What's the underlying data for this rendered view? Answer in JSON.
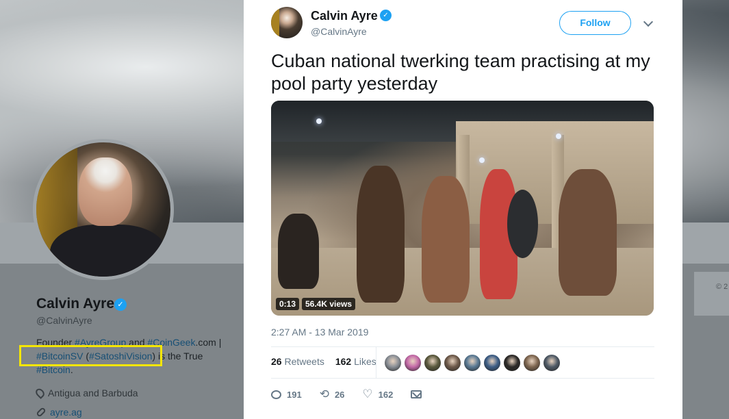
{
  "profile": {
    "name": "Calvin Ayre",
    "verified_mark": "✓",
    "handle": "@CalvinAyre",
    "bio": {
      "line1_prefix": "Founder ",
      "tag_ayre": "#AyreGroup",
      "and": " and ",
      "tag_coingeek": "#CoinGeek",
      "com": ".com |",
      "tag_bitcoinsv": "#BitcoinSV",
      "paren_open": " (",
      "tag_satoshi": "#SatoshiVision",
      "paren_close": ")",
      "is_true": " is the True",
      "tag_bitcoin": "#Bitcoin",
      "period": "."
    },
    "location": "Antigua and Barbuda",
    "website": "ayre.ag",
    "side_card_text": "© 2"
  },
  "tweet": {
    "author_name": "Calvin Ayre",
    "verified_mark": "✓",
    "author_handle": "@CalvinAyre",
    "follow_label": "Follow",
    "text": "Cuban national twerking team practising at my pool party yesterday",
    "video": {
      "duration": "0:13",
      "views": "56.4K views"
    },
    "timestamp": "2:27 AM - 13 Mar 2019",
    "stats": {
      "retweets_count": "26",
      "retweets_label": "Retweets",
      "likes_count": "162",
      "likes_label": "Likes"
    },
    "liker_colors": [
      "#8a8f96",
      "#c46aa8",
      "#5b5a3e",
      "#6e5a4a",
      "#5a7a94",
      "#3d5e86",
      "#2c2a28",
      "#7e6650",
      "#4f5a66"
    ],
    "actions": {
      "reply_count": "191",
      "retweet_count": "26",
      "like_count": "162"
    },
    "icons": {
      "retweet": "⟲",
      "like": "♡"
    }
  }
}
